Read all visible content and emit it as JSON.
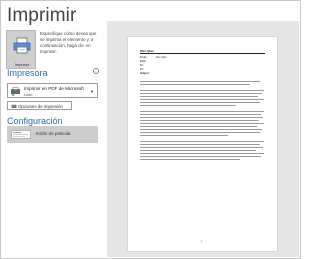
{
  "backstage": {
    "title": "Imprimir"
  },
  "print": {
    "button_label": "Imprimir",
    "description": "Especifique cómo desea que se imprima el elemento y, a continuación, haga clic en Imprimir."
  },
  "printer": {
    "heading": "Impresora",
    "selected_name": "Imprimir en PDF de Microsoft",
    "status": "Listo",
    "options_label": "Opciones de impresión"
  },
  "settings": {
    "heading": "Configuración",
    "style_label": "Estilo de pelicula"
  },
  "preview": {
    "from_name": "Wen Qiao",
    "page_number": "1",
    "header_rows": [
      {
        "key": "From:",
        "value": "Wen Qiao"
      },
      {
        "key": "Sent:",
        "value": ""
      },
      {
        "key": "To:",
        "value": ""
      },
      {
        "key": "Cc:",
        "value": ""
      },
      {
        "key": "Subject:",
        "value": ""
      }
    ]
  },
  "colors": {
    "accent": "#2b6cb0",
    "selected_bg": "#cdcdcd",
    "preview_bg": "#e6e6e6"
  },
  "icons": [
    "printer-icon",
    "pdf-printer-icon",
    "printer-options-icon",
    "memo-style-icon",
    "info-icon",
    "chevron-down-icon"
  ]
}
